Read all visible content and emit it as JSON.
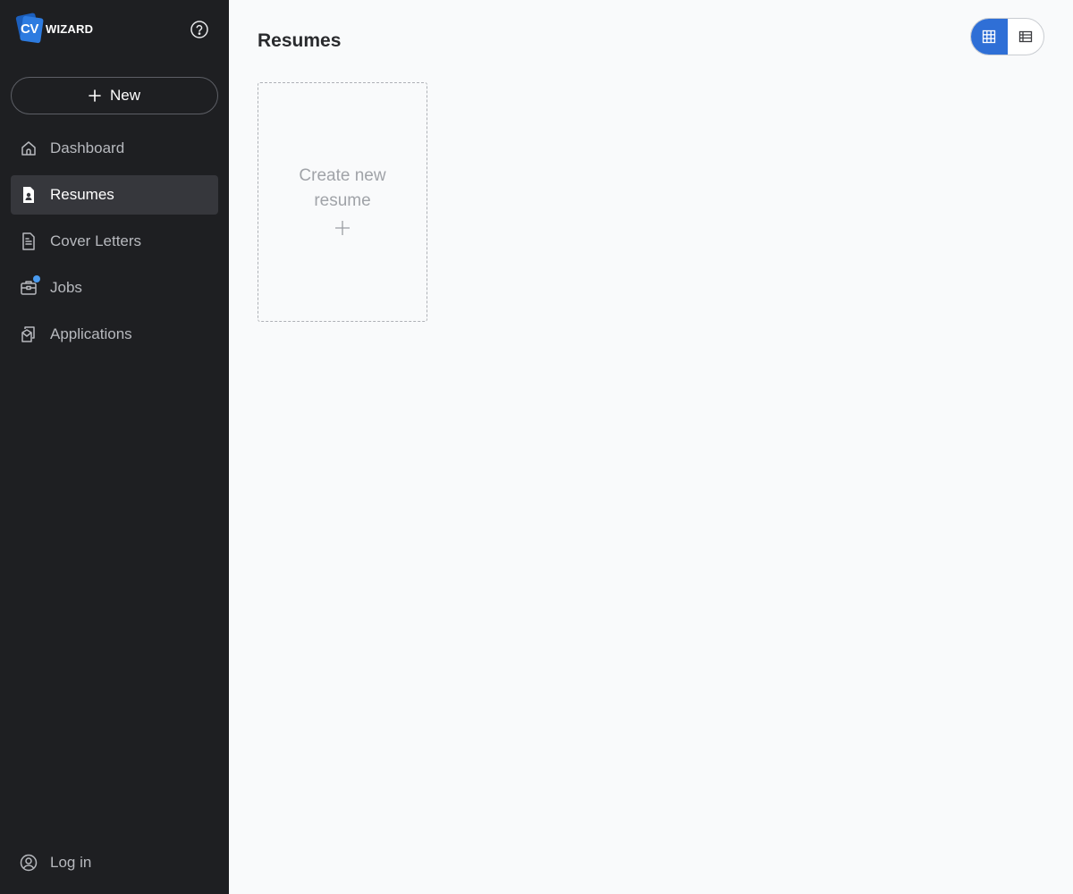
{
  "brand": {
    "mark_text": "CV",
    "name": "WIZARD",
    "accent": "#2d7be0"
  },
  "sidebar": {
    "new_label": "New",
    "items": [
      {
        "label": "Dashboard",
        "icon": "home-icon",
        "active": false
      },
      {
        "label": "Resumes",
        "icon": "resume-icon",
        "active": true
      },
      {
        "label": "Cover Letters",
        "icon": "document-icon",
        "active": false
      },
      {
        "label": "Jobs",
        "icon": "briefcase-icon",
        "active": false,
        "has_notification": true
      },
      {
        "label": "Applications",
        "icon": "applications-icon",
        "active": false
      }
    ],
    "login_label": "Log in"
  },
  "main": {
    "title": "Resumes",
    "view_mode": "grid",
    "create_card_label": "Create new resume"
  },
  "colors": {
    "sidebar_bg": "#1e1f22",
    "active_item_bg": "#36373c",
    "toggle_active": "#2f6fd6",
    "notification_dot": "#4a9bf0",
    "page_bg": "#f9fafb"
  }
}
